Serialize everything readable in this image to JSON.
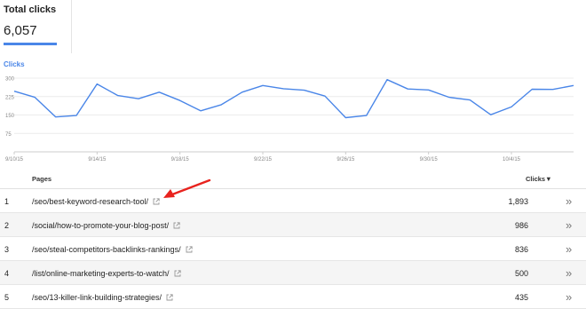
{
  "summary": {
    "title": "Total clicks",
    "value": "6,057",
    "accent_color": "#4a86e8"
  },
  "chart_data": {
    "type": "line",
    "legend": "Clicks",
    "series": [
      {
        "name": "Clicks",
        "color": "#4a86e8",
        "values": [
          247,
          222,
          142,
          148,
          276,
          229,
          216,
          243,
          209,
          167,
          192,
          243,
          270,
          257,
          251,
          227,
          139,
          148,
          294,
          256,
          252,
          222,
          211,
          151,
          183,
          255,
          254,
          270
        ]
      }
    ],
    "x_start": "9/10/15",
    "x_ticks": [
      "9/10/15",
      "9/14/15",
      "9/18/15",
      "9/22/15",
      "9/26/15",
      "9/30/15",
      "10/4/15"
    ],
    "y_ticks": [
      "300",
      "225",
      "150",
      "75"
    ],
    "ylim": [
      0,
      300
    ],
    "grid": true
  },
  "table": {
    "col_pages": "Pages",
    "col_clicks": "Clicks",
    "sort_indicator": "▼",
    "drill_glyph": "»",
    "rows": [
      {
        "num": "1",
        "page": "/seo/best-keyword-research-tool/",
        "clicks": "1,893"
      },
      {
        "num": "2",
        "page": "/social/how-to-promote-your-blog-post/",
        "clicks": "986"
      },
      {
        "num": "3",
        "page": "/seo/steal-competitors-backlinks-rankings/",
        "clicks": "836"
      },
      {
        "num": "4",
        "page": "/list/online-marketing-experts-to-watch/",
        "clicks": "500"
      },
      {
        "num": "5",
        "page": "/seo/13-killer-link-building-strategies/",
        "clicks": "435"
      }
    ]
  },
  "annotation": {
    "arrow_color": "#e8231e"
  }
}
